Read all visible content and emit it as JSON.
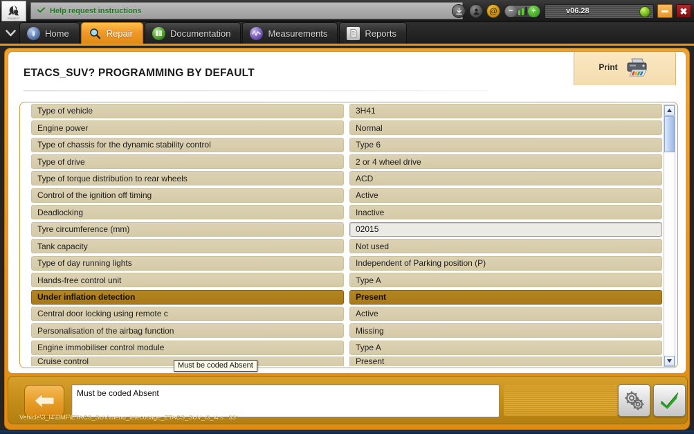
{
  "topbar": {
    "logo_name": "peugeot-lion-logo",
    "logo_word": "PEUGEOT",
    "help_text": "Help request instructions",
    "version": "v06.28",
    "icons": [
      "download-icon",
      "user-icon",
      "at-icon",
      "volume-control",
      "power-icon"
    ],
    "minimize_label": "",
    "close_label": "✖"
  },
  "tabs": [
    {
      "label": "Home",
      "icon": "home-icon",
      "active": false
    },
    {
      "label": "Repair",
      "icon": "magnifier-icon",
      "active": true
    },
    {
      "label": "Documentation",
      "icon": "book-icon",
      "active": false
    },
    {
      "label": "Measurements",
      "icon": "waveform-icon",
      "active": false
    },
    {
      "label": "Reports",
      "icon": "document-icon",
      "active": false
    }
  ],
  "panel": {
    "title": "ETACS_SUV?  PROGRAMMING BY DEFAULT",
    "print_label": "Print",
    "print_icon": "printer-icon"
  },
  "table": {
    "rows": [
      {
        "label": "Type of vehicle",
        "value": "3H41",
        "selected": false,
        "editable": false
      },
      {
        "label": "Engine power",
        "value": "Normal",
        "selected": false,
        "editable": false
      },
      {
        "label": "Type of chassis for the dynamic stability control",
        "value": "Type 6",
        "selected": false,
        "editable": false
      },
      {
        "label": "Type of drive",
        "value": "2 or 4 wheel drive",
        "selected": false,
        "editable": false
      },
      {
        "label": "Type of torque distribution to rear wheels",
        "value": "ACD",
        "selected": false,
        "editable": false
      },
      {
        "label": "Control of the ignition off timing",
        "value": "Active",
        "selected": false,
        "editable": false
      },
      {
        "label": "Deadlocking",
        "value": "Inactive",
        "selected": false,
        "editable": false
      },
      {
        "label": "Tyre circumference (mm)",
        "value": "02015",
        "selected": false,
        "editable": true
      },
      {
        "label": "Tank capacity",
        "value": "Not used",
        "selected": false,
        "editable": false
      },
      {
        "label": "Type of day running lights",
        "value": "Independent of Parking position (P)",
        "selected": false,
        "editable": false
      },
      {
        "label": "Hands-free control unit",
        "value": "Type A",
        "selected": false,
        "editable": false
      },
      {
        "label": "Under inflation detection",
        "value": "Present",
        "selected": true,
        "editable": false
      },
      {
        "label": "Central door locking using remote c",
        "value": "Active",
        "selected": false,
        "editable": false
      },
      {
        "label": "Personalisation of the airbag function",
        "value": "Missing",
        "selected": false,
        "editable": false
      },
      {
        "label": "Engine immobiliser control module",
        "value": "Type A",
        "selected": false,
        "editable": false
      },
      {
        "label": "Cruise control",
        "value": "Present",
        "selected": false,
        "editable": false
      }
    ]
  },
  "tooltip": {
    "text": "Must be coded Absent"
  },
  "bottom": {
    "message": "Must be coded Absent",
    "back_icon": "back-arrow-icon",
    "gears_icon": "gears-icon",
    "ok_icon": "green-check-icon",
    "status_path": "Vehicle\\3_I4\\BMF\\ETACS_SUV\\menu_telecodage_ETACS_SUV_i3_i4.s : 33*"
  },
  "colors": {
    "accent_orange": "#e8961f",
    "selected_row": "#a8791b",
    "row_bg": "#d5caa7",
    "panel_bg": "#ffffff",
    "help_text": "#1f7a1f"
  }
}
